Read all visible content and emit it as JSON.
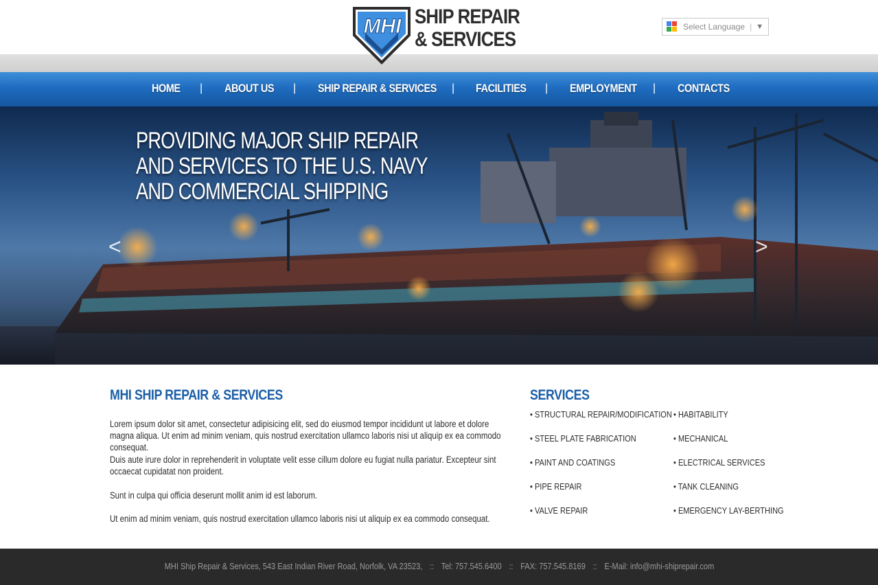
{
  "header": {
    "logo_mark": "MHI",
    "logo_line1": "SHIP REPAIR",
    "logo_line2": "& SERVICES",
    "language_label": "Select Language",
    "language_arrow": "▼"
  },
  "nav": {
    "items": [
      "HOME",
      "ABOUT US",
      "SHIP REPAIR & SERVICES",
      "FACILITIES",
      "EMPLOYMENT",
      "CONTACTS"
    ],
    "separator": "|"
  },
  "hero": {
    "title_lines": [
      "PROVIDING MAJOR SHIP REPAIR",
      "AND SERVICES TO THE U.S. NAVY",
      "AND COMMERCIAL SHIPPING"
    ],
    "prev": "<",
    "next": ">"
  },
  "about": {
    "title": "MHI SHIP REPAIR & SERVICES",
    "paragraphs": [
      "Lorem ipsum dolor sit amet, consectetur adipisicing elit, sed do eiusmod tempor incididunt ut labore et dolore magna aliqua. Ut enim ad minim veniam, quis nostrud exercitation ullamco laboris nisi ut aliquip ex ea commodo consequat.",
      "Duis aute irure dolor in reprehenderit in voluptate velit esse cillum dolore eu fugiat nulla pariatur. Excepteur sint occaecat cupidatat non proident.",
      "Sunt in culpa qui officia deserunt mollit anim id est laborum.",
      "Ut enim ad minim veniam, quis nostrud exercitation ullamco laboris nisi ut aliquip ex ea commodo consequat."
    ]
  },
  "services": {
    "title": "SERVICES",
    "left": [
      "• STRUCTURAL REPAIR/MODIFICATION",
      "• STEEL PLATE FABRICATION",
      "• PAINT AND COATINGS",
      "• PIPE REPAIR",
      "• VALVE REPAIR"
    ],
    "right": [
      "• HABITABILITY",
      "• MECHANICAL",
      "• ELECTRICAL SERVICES",
      "• TANK CLEANING",
      "• EMERGENCY LAY-BERTHING"
    ]
  },
  "footer": {
    "address": "MHI Ship Repair & Services, 543 East Indian River Road, Norfolk, VA  23523,",
    "tel": "Tel: 757.545.6400",
    "fax": "FAX: 757.545.8169",
    "email": "E-Mail: info@mhi-shiprepair.com",
    "separator": "::"
  },
  "colors": {
    "accent": "#1a5ea7",
    "nav_blue": "#1f6cc0",
    "footer_bg": "#2a2a2a"
  }
}
